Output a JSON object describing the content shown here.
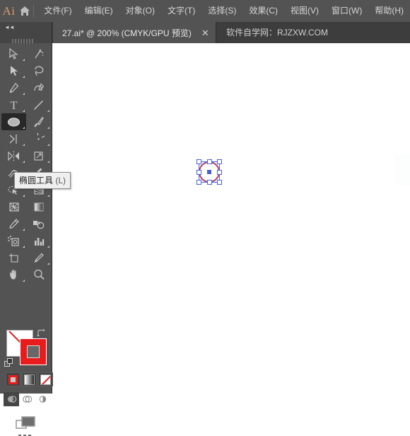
{
  "app": {
    "logo_text": "Ai",
    "home_icon": "home-icon"
  },
  "menubar": {
    "items": [
      {
        "label": "文件(F)",
        "name": "menu-file"
      },
      {
        "label": "编辑(E)",
        "name": "menu-edit"
      },
      {
        "label": "对象(O)",
        "name": "menu-object"
      },
      {
        "label": "文字(T)",
        "name": "menu-type"
      },
      {
        "label": "选择(S)",
        "name": "menu-select"
      },
      {
        "label": "效果(C)",
        "name": "menu-effect"
      },
      {
        "label": "视图(V)",
        "name": "menu-view"
      },
      {
        "label": "窗口(W)",
        "name": "menu-window"
      },
      {
        "label": "帮助(H)",
        "name": "menu-help"
      }
    ]
  },
  "tabbar": {
    "collapse_icon": "double-chevron-left-icon",
    "gripper_icon": "drag-gripper-icon",
    "document_tab": {
      "title": "27.ai* @ 200% (CMYK/GPU 预览)",
      "close_label": "✕"
    },
    "watermark": "软件自学网：RJZXW.COM"
  },
  "toolbar": {
    "tools": [
      {
        "label": "选择工具",
        "icon": "selection-arrow-icon",
        "menu": true
      },
      {
        "label": "魔棒工具",
        "icon": "magic-wand-icon",
        "menu": false
      },
      {
        "label": "直接选择工具",
        "icon": "direct-selection-arrow-icon",
        "menu": true
      },
      {
        "label": "套索工具",
        "icon": "lasso-icon",
        "menu": false
      },
      {
        "label": "钢笔工具",
        "icon": "pen-icon",
        "menu": true
      },
      {
        "label": "曲率工具",
        "icon": "curvature-icon",
        "menu": false
      },
      {
        "label": "文字工具",
        "icon": "type-t-icon",
        "menu": true
      },
      {
        "label": "直线段工具",
        "icon": "line-segment-icon",
        "menu": true
      },
      {
        "label": "椭圆工具",
        "icon": "ellipse-icon",
        "menu": true,
        "selected": true
      },
      {
        "label": "画笔工具",
        "icon": "paintbrush-icon",
        "menu": true
      },
      {
        "label": "橡皮擦工具",
        "icon": "shaper-eraser-icon",
        "menu": true
      },
      {
        "label": "旋转工具",
        "icon": "rotate-icon",
        "menu": true
      },
      {
        "label": "镜像工具",
        "icon": "reflect-icon",
        "menu": true
      },
      {
        "label": "比例缩放工具",
        "icon": "scale-icon",
        "menu": true
      },
      {
        "label": "宽度工具",
        "icon": "width-warp-icon",
        "menu": true
      },
      {
        "label": "自由变换工具",
        "icon": "free-transform-pin-icon",
        "menu": false
      },
      {
        "label": "形状生成器工具",
        "icon": "shape-builder-icon",
        "menu": true
      },
      {
        "label": "透视网格工具",
        "icon": "perspective-grid-icon",
        "menu": true
      },
      {
        "label": "网格工具",
        "icon": "mesh-icon",
        "menu": false
      },
      {
        "label": "渐变工具",
        "icon": "gradient-icon",
        "menu": false
      },
      {
        "label": "吸管工具",
        "icon": "eyedropper-icon",
        "menu": true
      },
      {
        "label": "混合工具",
        "icon": "blend-icon",
        "menu": false
      },
      {
        "label": "符号喷枪工具",
        "icon": "symbol-sprayer-icon",
        "menu": true
      },
      {
        "label": "柱形图工具",
        "icon": "column-graph-icon",
        "menu": true
      },
      {
        "label": "画板工具",
        "icon": "artboard-icon",
        "menu": false
      },
      {
        "label": "切片工具",
        "icon": "slice-knife-icon",
        "menu": true
      },
      {
        "label": "抓手工具",
        "icon": "hand-icon",
        "menu": true
      },
      {
        "label": "缩放工具",
        "icon": "zoom-magnifier-icon",
        "menu": false
      }
    ],
    "tooltip": {
      "text": "椭圆工具",
      "shortcut": "(L)"
    },
    "fill": {
      "name": "fill-swatch",
      "value": "none",
      "color": "#ffffff",
      "slash_color": "#e01b1b"
    },
    "stroke": {
      "name": "stroke-swatch",
      "value": "red",
      "color": "#e81c1c"
    },
    "swap_icon": "swap-fill-stroke-icon",
    "default_colors_icon": "default-fill-stroke-icon",
    "paint_modes": [
      {
        "label": "颜色",
        "icon": "color-swatch-icon",
        "active": true
      },
      {
        "label": "渐变",
        "icon": "gradient-swatch-icon",
        "active": false
      },
      {
        "label": "无",
        "icon": "none-swatch-icon",
        "active": false
      }
    ],
    "draw_modes": [
      {
        "label": "正常绘图",
        "icon": "draw-normal-icon",
        "active": true
      },
      {
        "label": "背面绘图",
        "icon": "draw-behind-icon",
        "active": false
      },
      {
        "label": "内部绘图",
        "icon": "draw-inside-icon",
        "active": false
      }
    ],
    "screen_mode": {
      "label": "更改屏幕模式",
      "icon": "screen-mode-icon"
    }
  },
  "canvas": {
    "zoom_percent": "200%",
    "background": "#ffffff",
    "selection": {
      "object": "ellipse",
      "stroke_color": "#e2342f",
      "fill": "none",
      "handle_color": "#4a60d8",
      "handle_count": 8,
      "center_point": true
    }
  },
  "colors": {
    "menubar_bg": "#535353",
    "tabbar_bg": "#3d3d3d",
    "panel_bg": "#535353",
    "selected_tool_bg": "#282828",
    "accent_red": "#e81c1c",
    "selection_blue": "#4a60d8",
    "logo_orange": "#d89a68"
  }
}
